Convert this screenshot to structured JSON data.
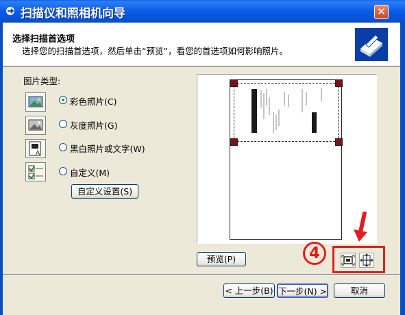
{
  "window": {
    "title": "扫描仪和照相机向导",
    "close_glyph": "✕"
  },
  "header": {
    "title": "选择扫描首选项",
    "subtitle": "选择您的扫描首选项，然后单击“预览”，看您的首选项如何影响照片。"
  },
  "picture_type": {
    "label": "图片类型:",
    "options": [
      {
        "label": "彩色照片(C)",
        "selected": true
      },
      {
        "label": "灰度照片(G)",
        "selected": false
      },
      {
        "label": "黑白照片或文字(W)",
        "selected": false
      },
      {
        "label": "自定义(M)",
        "selected": false
      }
    ],
    "custom_settings_button": "自定义设置(S)"
  },
  "preview": {
    "preview_button": "预览(P)",
    "zoom_selection_icon": "zoom-to-selection-icon",
    "fit_page_icon": "fit-page-icon"
  },
  "annotation": {
    "step_number": "4",
    "arrow_color": "#e31d1d"
  },
  "footer": {
    "back_button": "< 上一步(B)",
    "next_button": "下一步(N) >",
    "cancel_button": "取消"
  }
}
